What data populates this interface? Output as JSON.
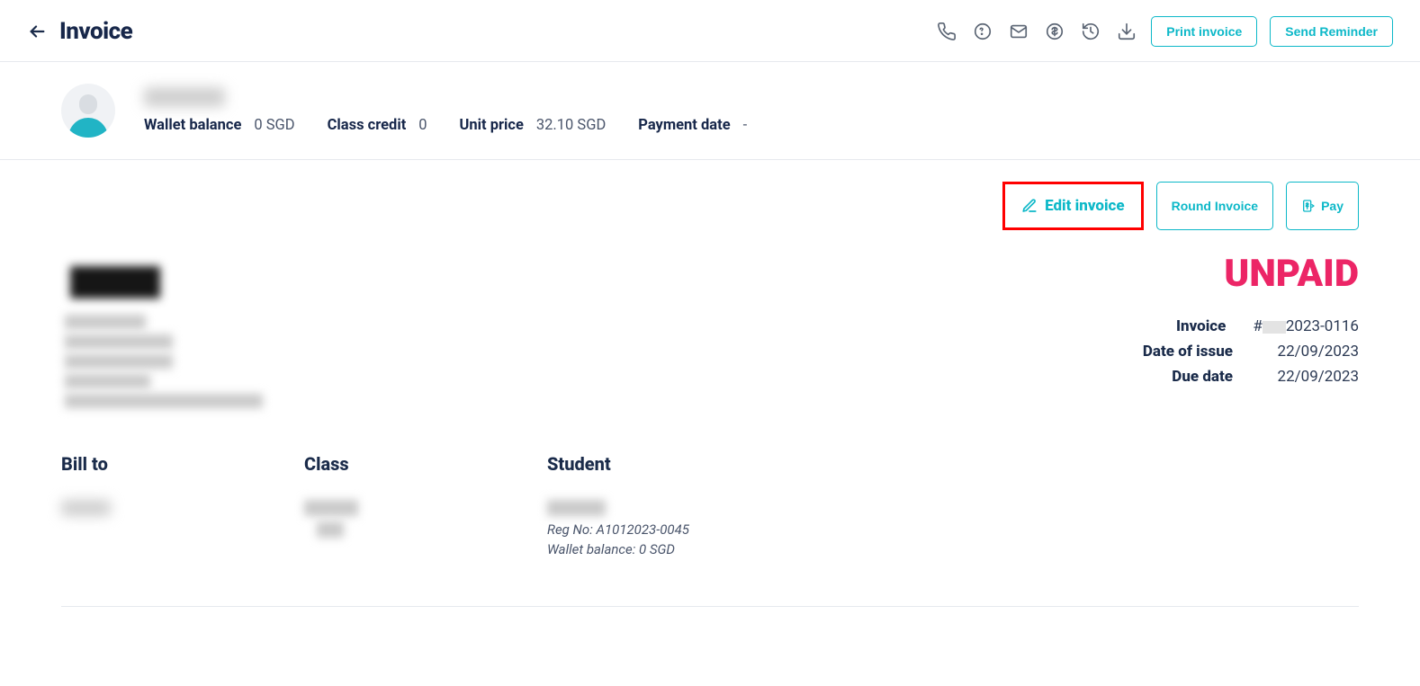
{
  "header": {
    "page_title": "Invoice",
    "print_label": "Print invoice",
    "reminder_label": "Send Reminder"
  },
  "summary": {
    "wallet_balance_label": "Wallet balance",
    "wallet_balance_value": "0 SGD",
    "class_credit_label": "Class credit",
    "class_credit_value": "0",
    "unit_price_label": "Unit price",
    "unit_price_value": "32.10 SGD",
    "payment_date_label": "Payment date",
    "payment_date_value": "-"
  },
  "actions": {
    "edit_invoice_label": "Edit invoice",
    "round_invoice_label": "Round Invoice",
    "pay_label": "Pay"
  },
  "status": {
    "unpaid_label": "UNPAID",
    "invoice_label": "Invoice",
    "invoice_number_prefix": "#",
    "invoice_number_visible_suffix": "2023-0116",
    "date_of_issue_label": "Date of issue",
    "date_of_issue_value": "22/09/2023",
    "due_date_label": "Due date",
    "due_date_value": "22/09/2023"
  },
  "parties": {
    "bill_to_label": "Bill to",
    "class_label": "Class",
    "student_label": "Student",
    "student_reg_no": "Reg No: A1012023-0045",
    "student_wallet": "Wallet balance: 0 SGD"
  }
}
